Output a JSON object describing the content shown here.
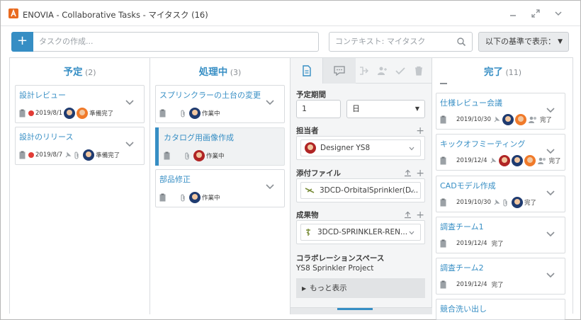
{
  "window": {
    "title": "ENOVIA - Collaborative Tasks - マイタスク (16)"
  },
  "toolbar": {
    "add_label": "+",
    "new_task_placeholder": "タスクの作成...",
    "context_placeholder": "コンテキスト: マイタスク",
    "sort_label": "以下の基準で表示："
  },
  "columns": {
    "planned": {
      "name": "予定",
      "count": "(2)",
      "cards": [
        {
          "title": "設計レビュー",
          "date": "2019/8/1",
          "status": "準備完了"
        },
        {
          "title": "設計のリリース",
          "date": "2019/8/7",
          "status": "準備完了"
        }
      ]
    },
    "in_progress": {
      "name": "処理中",
      "count": "(3)",
      "cards": [
        {
          "title": "スプリンクラーの土台の変更",
          "status": "作業中"
        },
        {
          "title": "カタログ用画像作成",
          "status": "作業中"
        },
        {
          "title": "部品修正",
          "status": "作業中"
        }
      ]
    },
    "done": {
      "name": "完了",
      "count": "(11)",
      "cards": [
        {
          "title": "仕様レビュー会議",
          "date": "2019/10/30",
          "status": "完了"
        },
        {
          "title": "キックオフミーティング",
          "date": "2019/12/4",
          "status": "完了"
        },
        {
          "title": "CADモデル作成",
          "date": "2019/10/30",
          "status": "完了"
        },
        {
          "title": "調査チーム1",
          "date": "2019/12/4",
          "status": "完了"
        },
        {
          "title": "調査チーム2",
          "date": "2019/12/4",
          "status": "完了"
        },
        {
          "title": "競合洗い出し"
        }
      ]
    }
  },
  "detail": {
    "duration_label": "予定期間",
    "duration_value": "1",
    "duration_unit": "日",
    "assignee_label": "担当者",
    "assignee": "Designer YS8",
    "attachments_label": "添付ファイル",
    "attachment": "3DCD-OrbitalSprinkler(D...",
    "deliverables_label": "成果物",
    "deliverable": "3DCD-SPRINKLER-REN...",
    "collab_space_label": "コラボレーションスペース",
    "collab_space": "YS8 Sprinkler Project",
    "more_label": "もっと表示"
  },
  "colors": {
    "accent": "#368ec4",
    "overdue": "#e23c36"
  }
}
